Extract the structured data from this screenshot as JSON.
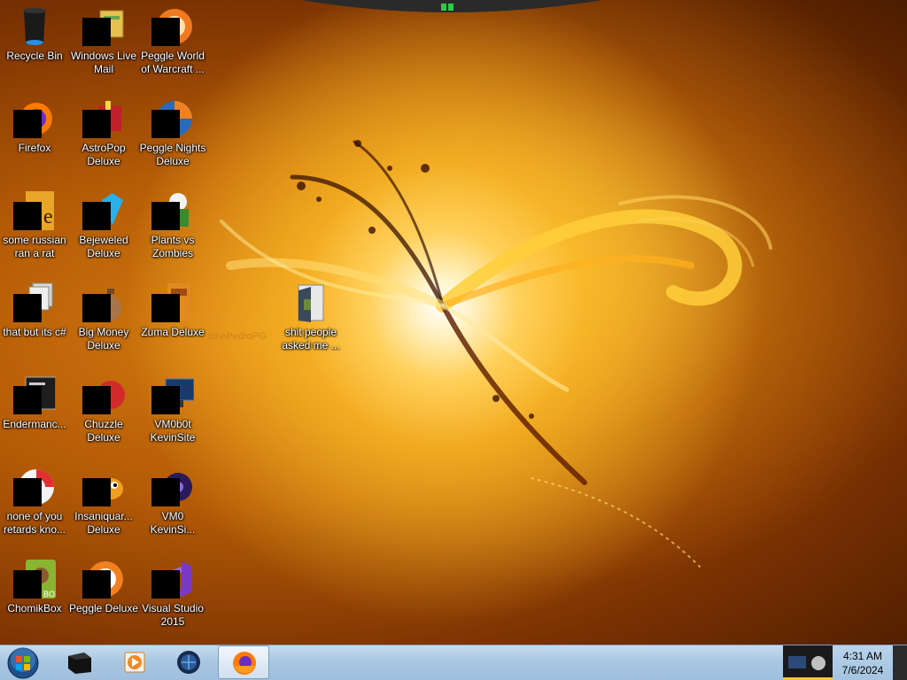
{
  "desktop": {
    "watermark": "tonePedroPG",
    "icons": [
      {
        "label": "Recycle Bin",
        "icon": "recycle-bin-icon"
      },
      {
        "label": "Windows Live\nMail",
        "icon": "windows-live-mail-icon"
      },
      {
        "label": "Peggle World\nof Warcraft ...",
        "icon": "peggle-world-of-warcraft-icon"
      },
      {
        "label": "Firefox",
        "icon": "firefox-icon"
      },
      {
        "label": "AstroPop\nDeluxe",
        "icon": "astropop-icon"
      },
      {
        "label": "Peggle Nights\nDeluxe",
        "icon": "peggle-nights-icon"
      },
      {
        "label": "some russian\nran a rat",
        "icon": "document-icon"
      },
      {
        "label": "Bejeweled\nDeluxe",
        "icon": "bejeweled-icon"
      },
      {
        "label": "Plants vs\nZombies",
        "icon": "plants-vs-zombies-icon"
      },
      {
        "label": "that but its c#",
        "icon": "file-stack-icon"
      },
      {
        "label": "Big Money\nDeluxe",
        "icon": "big-money-icon"
      },
      {
        "label": "Zuma Deluxe",
        "icon": "zuma-icon"
      },
      {
        "label": "Endermanc...",
        "icon": "console-app-icon"
      },
      {
        "label": "Chuzzle\nDeluxe",
        "icon": "chuzzle-icon"
      },
      {
        "label": "VM0b0t\nKevinSite",
        "icon": "vm-monitor-icon"
      },
      {
        "label": "none of you\nretards kno...",
        "icon": "chrome-like-icon"
      },
      {
        "label": "Insaniquar...\nDeluxe",
        "icon": "insaniquarium-icon"
      },
      {
        "label": "VM0\nKevinSi...",
        "icon": "vm-app-icon"
      },
      {
        "label": "ChomikBox",
        "icon": "chomikbox-icon"
      },
      {
        "label": "Peggle Deluxe",
        "icon": "peggle-deluxe-icon"
      },
      {
        "label": "Visual Studio\n2015",
        "icon": "visual-studio-icon"
      },
      {
        "label": "shit people\nasked me ...",
        "icon": "folder-icon"
      }
    ]
  },
  "taskbar": {
    "start_icon": "windows-orb-icon",
    "pinned": [
      {
        "icon": "cmd-icon"
      },
      {
        "icon": "media-player-icon"
      },
      {
        "icon": "globe-app-icon"
      },
      {
        "icon": "firefox-icon",
        "active": true
      }
    ],
    "clock": {
      "time": "4:31 AM",
      "date": "7/6/2024"
    }
  },
  "colors": {
    "wallpaper_main": "#b35a06",
    "wallpaper_glow": "#ffd05a",
    "taskbar": "#a9c7e2",
    "label_text": "#ffffff"
  }
}
